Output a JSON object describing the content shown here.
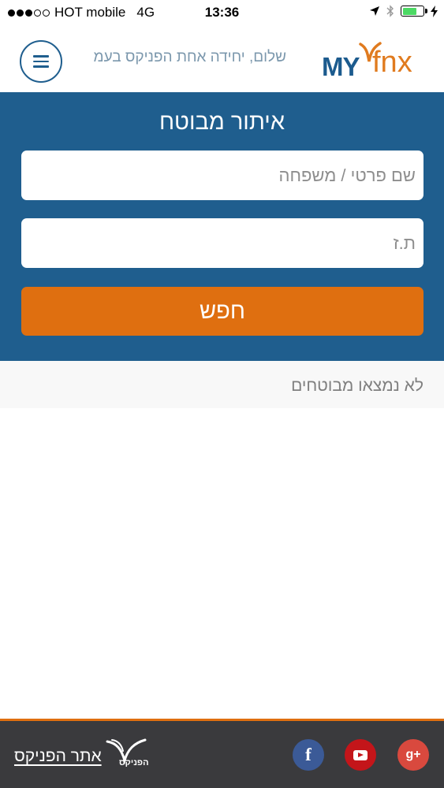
{
  "status_bar": {
    "carrier": "HOT mobile",
    "network": "4G",
    "time": "13:36",
    "battery_level": 0.72,
    "battery_color": "#4cd964"
  },
  "header": {
    "logo_my": "MY",
    "logo_fnx": "fnx",
    "greeting": "שלום, יחידה אחת הפניקס בעמ",
    "menu_icon": "hamburger-icon"
  },
  "search": {
    "title": "איתור מבוטח",
    "name_placeholder": "שם פרטי / משפחה",
    "name_value": "",
    "id_placeholder": "ת.ז",
    "id_value": "",
    "button_label": "חפש"
  },
  "results": {
    "message": "לא נמצאו מבוטחים"
  },
  "footer": {
    "social": [
      "google-plus-icon",
      "youtube-icon",
      "facebook-icon"
    ],
    "gplus_label": "g+",
    "facebook_label": "f",
    "logo_text": "הפניקס",
    "site_link": "אתר הפניקס"
  },
  "colors": {
    "brand_blue": "#1f5e8e",
    "brand_orange": "#df6f10",
    "footer_bg": "#3a3a3d"
  }
}
